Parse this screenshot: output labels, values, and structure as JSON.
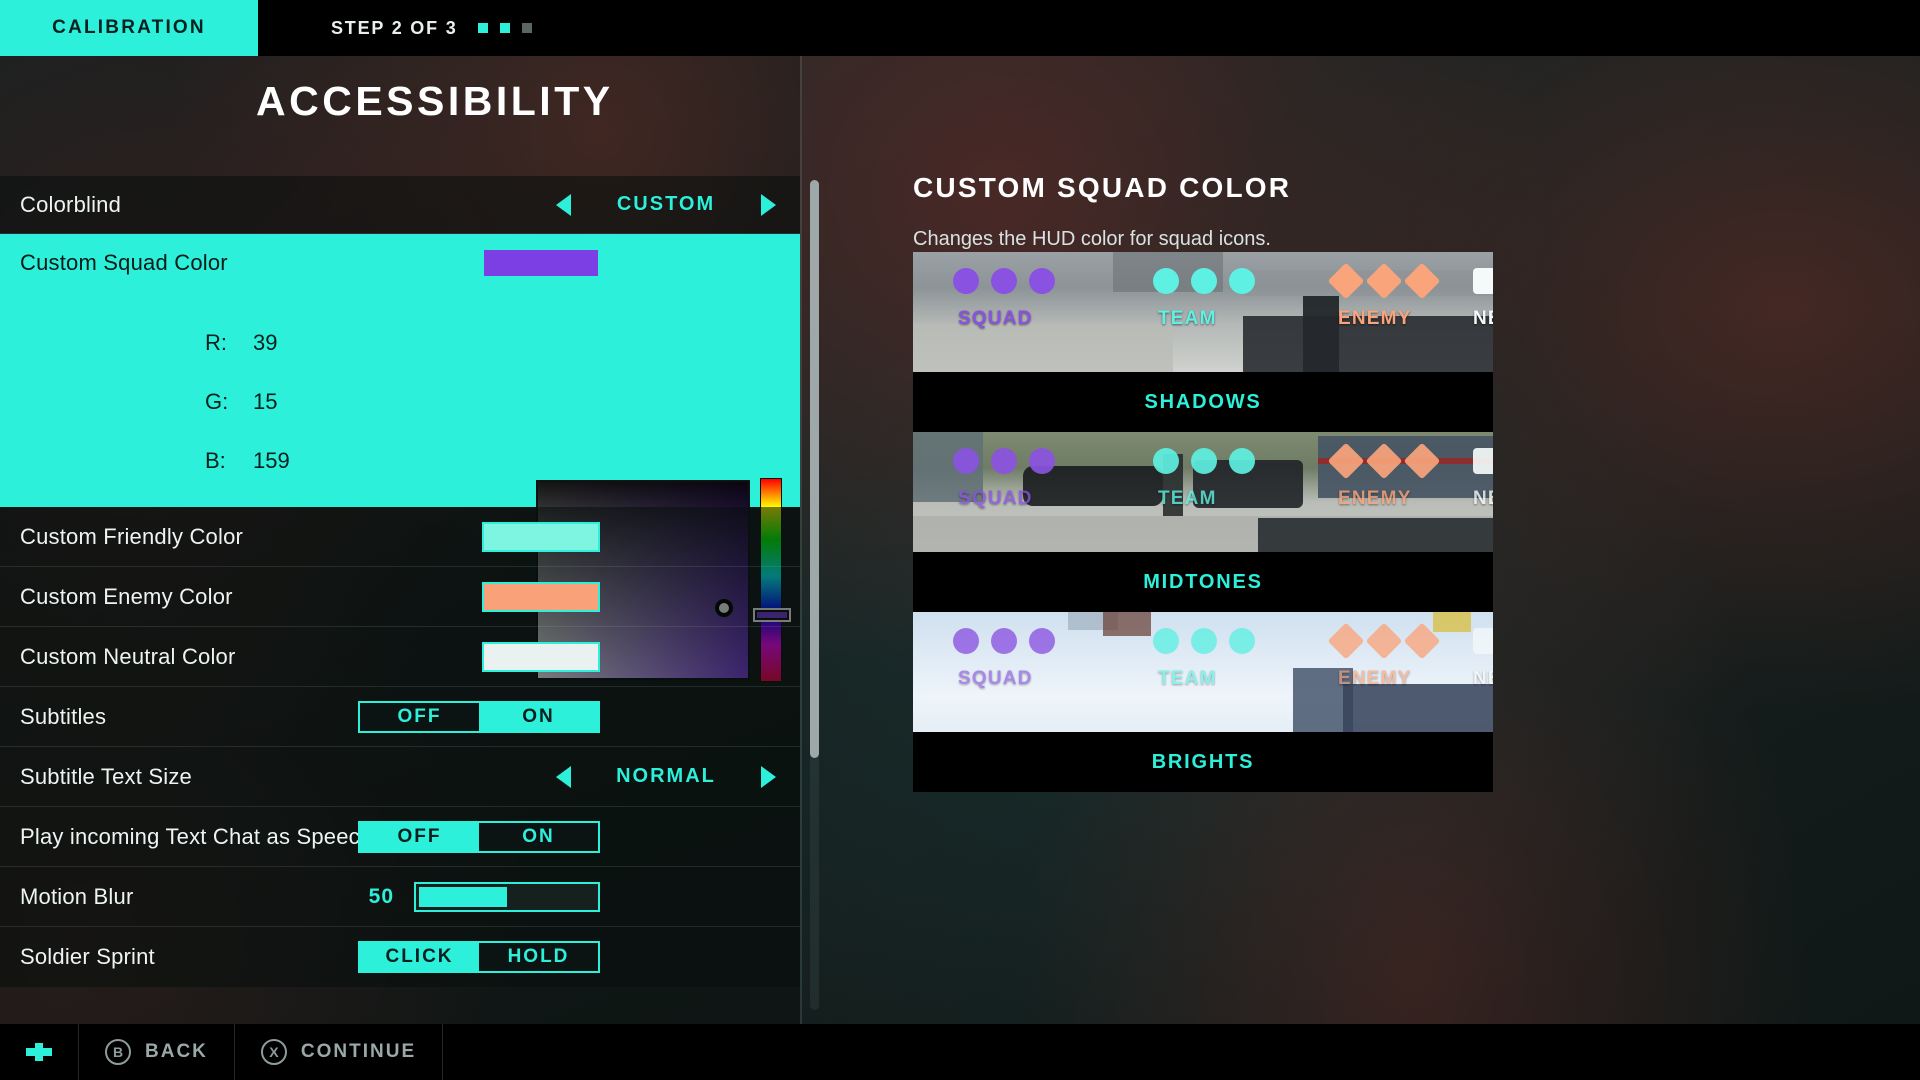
{
  "topbar": {
    "tab_label": "CALIBRATION",
    "step_label": "STEP 2 OF 3",
    "step_dots": [
      {
        "state": "done",
        "color": "#2df0da"
      },
      {
        "state": "current",
        "color": "#2df0da"
      },
      {
        "state": "todo",
        "color": "#5a6565"
      }
    ]
  },
  "page": {
    "title": "ACCESSIBILITY"
  },
  "settings": {
    "colorblind": {
      "label": "Colorblind",
      "value": "CUSTOM",
      "left_arrow": "prev",
      "right_arrow": "next"
    },
    "custom_squad_color": {
      "label": "Custom Squad Color",
      "swatch_color": "#7b3fe4",
      "rgb": [
        {
          "key": "R:",
          "value": "39"
        },
        {
          "key": "G:",
          "value": "15"
        },
        {
          "key": "B:",
          "value": "159"
        }
      ]
    },
    "custom_friendly_color": {
      "label": "Custom Friendly Color",
      "swatch_color": "#7df5e0"
    },
    "custom_enemy_color": {
      "label": "Custom Enemy Color",
      "swatch_color": "#f9a279"
    },
    "custom_neutral_color": {
      "label": "Custom Neutral Color",
      "swatch_color": "#e9f1f1"
    },
    "subtitles": {
      "label": "Subtitles",
      "options": [
        "OFF",
        "ON"
      ],
      "selected": "ON"
    },
    "subtitle_text_size": {
      "label": "Subtitle Text Size",
      "value": "NORMAL"
    },
    "text_chat_speech": {
      "label": "Play incoming Text Chat as Speech",
      "options": [
        "OFF",
        "ON"
      ],
      "selected": "OFF"
    },
    "motion_blur": {
      "label": "Motion Blur",
      "value": "50",
      "fill_percent": 50
    },
    "soldier_sprint": {
      "label": "Soldier Sprint",
      "options": [
        "CLICK",
        "HOLD"
      ],
      "selected": "CLICK"
    }
  },
  "right_panel": {
    "title": "CUSTOM SQUAD COLOR",
    "description": "Changes the HUD color for squad icons.",
    "groups": [
      {
        "name": "SQUAD",
        "shape": "circle",
        "color": "#8a52e0"
      },
      {
        "name": "TEAM",
        "shape": "circle",
        "color": "#5ef0e2"
      },
      {
        "name": "ENEMY",
        "shape": "diamond",
        "color": "#f9a47b"
      },
      {
        "name": "NEUTRAL",
        "shape": "square",
        "color": "#f4f9f9"
      }
    ],
    "previews": [
      {
        "caption": "SHADOWS",
        "scene": "urban-rooftop"
      },
      {
        "caption": "MIDTONES",
        "scene": "street-vehicles"
      },
      {
        "caption": "BRIGHTS",
        "scene": "snowfield"
      }
    ]
  },
  "bottombar": {
    "dpad_icon": "dpad-icon",
    "actions": [
      {
        "glyph": "B",
        "label": "BACK"
      },
      {
        "glyph": "X",
        "label": "CONTINUE"
      }
    ]
  }
}
